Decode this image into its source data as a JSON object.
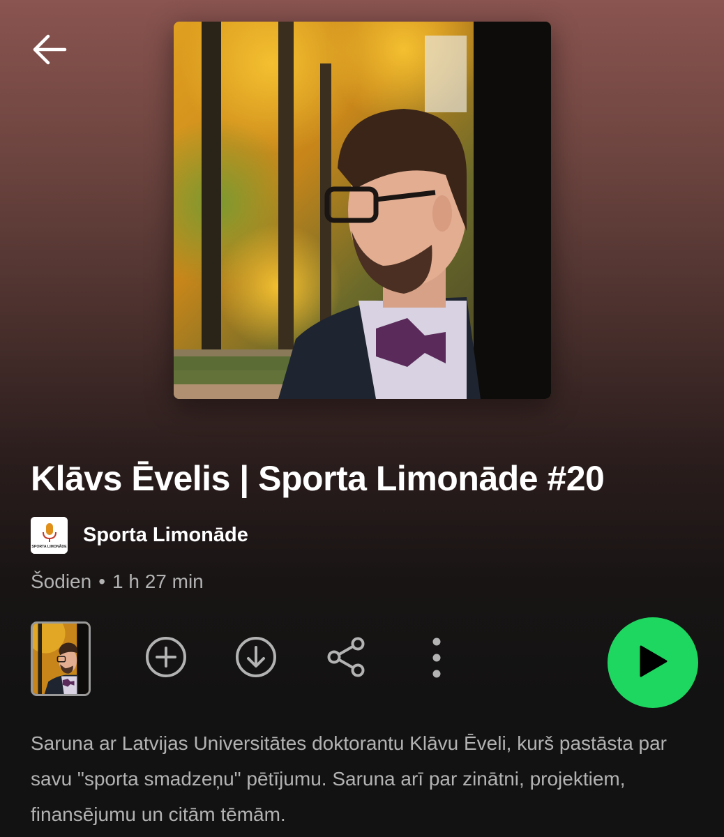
{
  "header": {
    "back_icon": "arrow-left-icon"
  },
  "episode": {
    "title": "Klāvs Ēvelis | Sporta Limonāde #20",
    "cover_image": "portrait-photo-man-glasses-bowtie-autumn"
  },
  "show": {
    "name": "Sporta Limonāde",
    "logo_icon": "microphone-logo-icon",
    "logo_text": "SPORTA LIMONĀDE"
  },
  "meta": {
    "date": "Šodien",
    "separator": "•",
    "duration": "1 h 27 min"
  },
  "actions": {
    "add_icon": "plus-circle-icon",
    "download_icon": "download-circle-icon",
    "share_icon": "share-icon",
    "more_icon": "more-vertical-icon",
    "play_icon": "play-icon"
  },
  "description": "Saruna ar Latvijas Universitātes doktorantu Klāvu Ēveli, kurš pastāsta par savu \"sporta smadzeņu\" pētījumu. Saruna arī par zinātni, projektiem, finansējumu un citām tēmām.",
  "colors": {
    "accent": "#1ed760",
    "secondary_text": "#b3b3b3",
    "background": "#121212",
    "header_tint": "#8a5450"
  }
}
